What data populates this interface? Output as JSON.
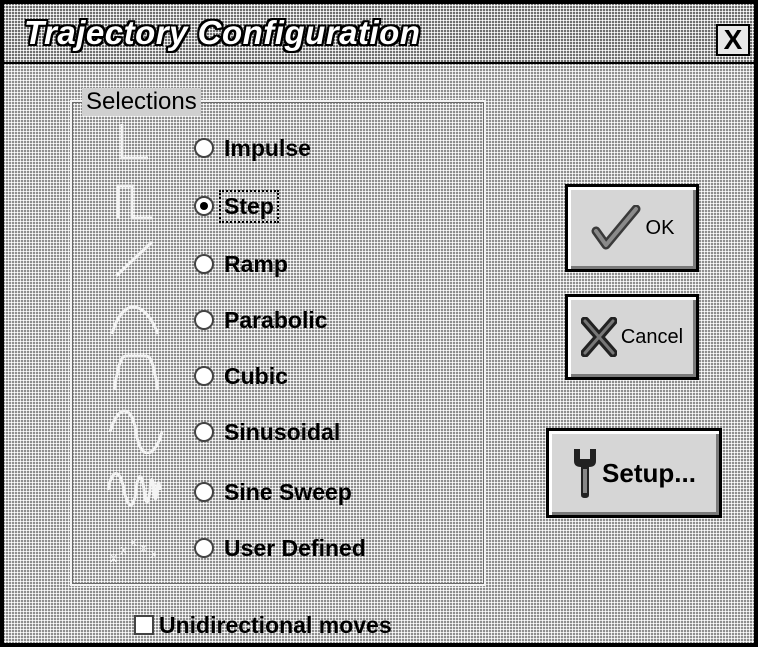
{
  "window": {
    "title": "Trajectory Configuration",
    "close_label": "X"
  },
  "selections": {
    "group_label": "Selections",
    "selected": "step",
    "options": [
      {
        "id": "impulse",
        "label": "Impulse",
        "mnemonic": "I",
        "icon": "impulse-icon"
      },
      {
        "id": "step",
        "label": "Step",
        "mnemonic": "t",
        "icon": "step-icon"
      },
      {
        "id": "ramp",
        "label": "Ramp",
        "mnemonic": "R",
        "icon": "ramp-icon"
      },
      {
        "id": "parabolic",
        "label": "Parabolic",
        "mnemonic": "P",
        "icon": "parabolic-icon"
      },
      {
        "id": "cubic",
        "label": "Cubic",
        "mnemonic": "u",
        "icon": "cubic-icon"
      },
      {
        "id": "sinusoidal",
        "label": "Sinusoidal",
        "mnemonic": "S",
        "icon": "sinusoidal-icon"
      },
      {
        "id": "sine-sweep",
        "label": "Sine Sweep",
        "mnemonic": "w",
        "icon": "sine-sweep-icon"
      },
      {
        "id": "user-defined",
        "label": "User Defined",
        "mnemonic": "D",
        "icon": "user-defined-icon"
      }
    ]
  },
  "buttons": {
    "ok_label": "OK",
    "cancel_label": "Cancel",
    "setup_label": "Setup..."
  },
  "options": {
    "unidirectional_label": "Unidirectional moves",
    "unidirectional_checked": false
  }
}
